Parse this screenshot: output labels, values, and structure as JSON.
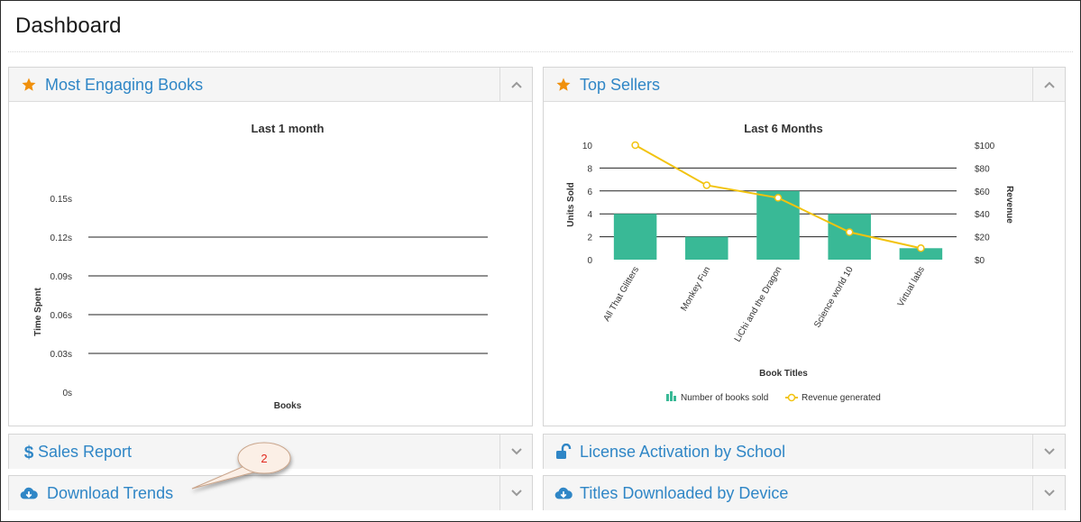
{
  "page": {
    "title": "Dashboard"
  },
  "colors": {
    "link": "#2f86c6",
    "star": "#f0900c",
    "bar": "#39b996",
    "line": "#f2c30f",
    "callout_text": "#e0281e"
  },
  "panels": {
    "most_engaging": {
      "title": "Most Engaging Books",
      "icon": "star-icon",
      "toggle_icon": "chevron-up-icon"
    },
    "top_sellers": {
      "title": "Top Sellers",
      "icon": "star-icon",
      "toggle_icon": "chevron-up-icon"
    },
    "sales_report": {
      "title": "Sales Report",
      "icon": "dollar-icon",
      "toggle_icon": "chevron-down-icon"
    },
    "license_activation": {
      "title": "License Activation by School",
      "icon": "unlock-icon",
      "toggle_icon": "chevron-down-icon"
    },
    "download_trends": {
      "title": "Download Trends",
      "icon": "cloud-download-icon",
      "toggle_icon": "chevron-down-icon"
    },
    "titles_downloaded": {
      "title": "Titles Downloaded by Device",
      "icon": "cloud-download-icon",
      "toggle_icon": "chevron-down-icon"
    }
  },
  "callout": {
    "label": "2"
  },
  "chart_data": [
    {
      "type": "line",
      "title": "Last 1 month",
      "xlabel": "Books",
      "ylabel": "Time Spent",
      "y_ticks": [
        "0s",
        "0.03s",
        "0.06s",
        "0.09s",
        "0.12s",
        "0.15s"
      ],
      "ylim": [
        0,
        0.15
      ],
      "categories": [],
      "series": [],
      "grid": true
    },
    {
      "type": "bar",
      "title": "Last 6 Months",
      "xlabel": "Book Titles",
      "ylabel": "Units Sold",
      "y2label": "Revenue",
      "categories": [
        "All That Glitters",
        "Monkey Fun",
        "LiChi and the Dragon",
        "Science world 10",
        "Virtual labs"
      ],
      "ylim": [
        0,
        10
      ],
      "y_ticks": [
        "0",
        "2",
        "4",
        "6",
        "8",
        "10"
      ],
      "y2lim": [
        0,
        100
      ],
      "y2_ticks": [
        "$0",
        "$20",
        "$40",
        "$60",
        "$80",
        "$100"
      ],
      "series": [
        {
          "name": "Number of books sold",
          "type": "bar",
          "values": [
            4,
            2,
            6,
            4,
            1
          ]
        },
        {
          "name": "Revenue generated",
          "type": "line",
          "axis": "right",
          "values": [
            100,
            65,
            54,
            24,
            10
          ]
        }
      ],
      "legend": "bottom",
      "grid": true
    }
  ]
}
